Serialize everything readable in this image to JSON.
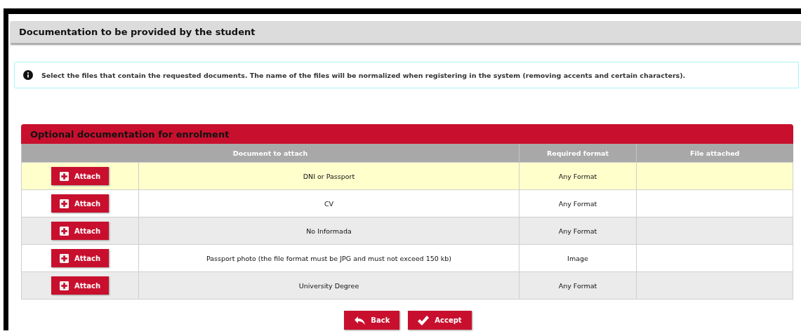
{
  "panel": {
    "title": "Documentation to be provided by the student"
  },
  "info": {
    "text": "Select the files that contain the requested documents. The name of the files will be normalized when registering in the system (removing accents and certain characters)."
  },
  "section": {
    "title": "Optional documentation for enrolment"
  },
  "table": {
    "columns": [
      "Document to attach",
      "Required format",
      "File attached"
    ],
    "rows": [
      {
        "button": "Attach",
        "document": "DNI or Passport",
        "format": "Any Format",
        "selected": true
      },
      {
        "button": "Attach",
        "document": "CV",
        "format": "Any Format",
        "selected": false
      },
      {
        "button": "Attach",
        "document": "No Informada",
        "format": "Any Format",
        "selected": false
      },
      {
        "button": "Attach",
        "document": "Passport photo (the file format must be JPG and must not exceed 150 kb)",
        "format": "Image",
        "selected": false
      },
      {
        "button": "Attach",
        "document": "University Degree",
        "format": "Any Format",
        "selected": false
      }
    ]
  },
  "buttons": [
    {
      "kind": "back",
      "label": "Back"
    },
    {
      "kind": "accept",
      "label": "Accept"
    }
  ]
}
